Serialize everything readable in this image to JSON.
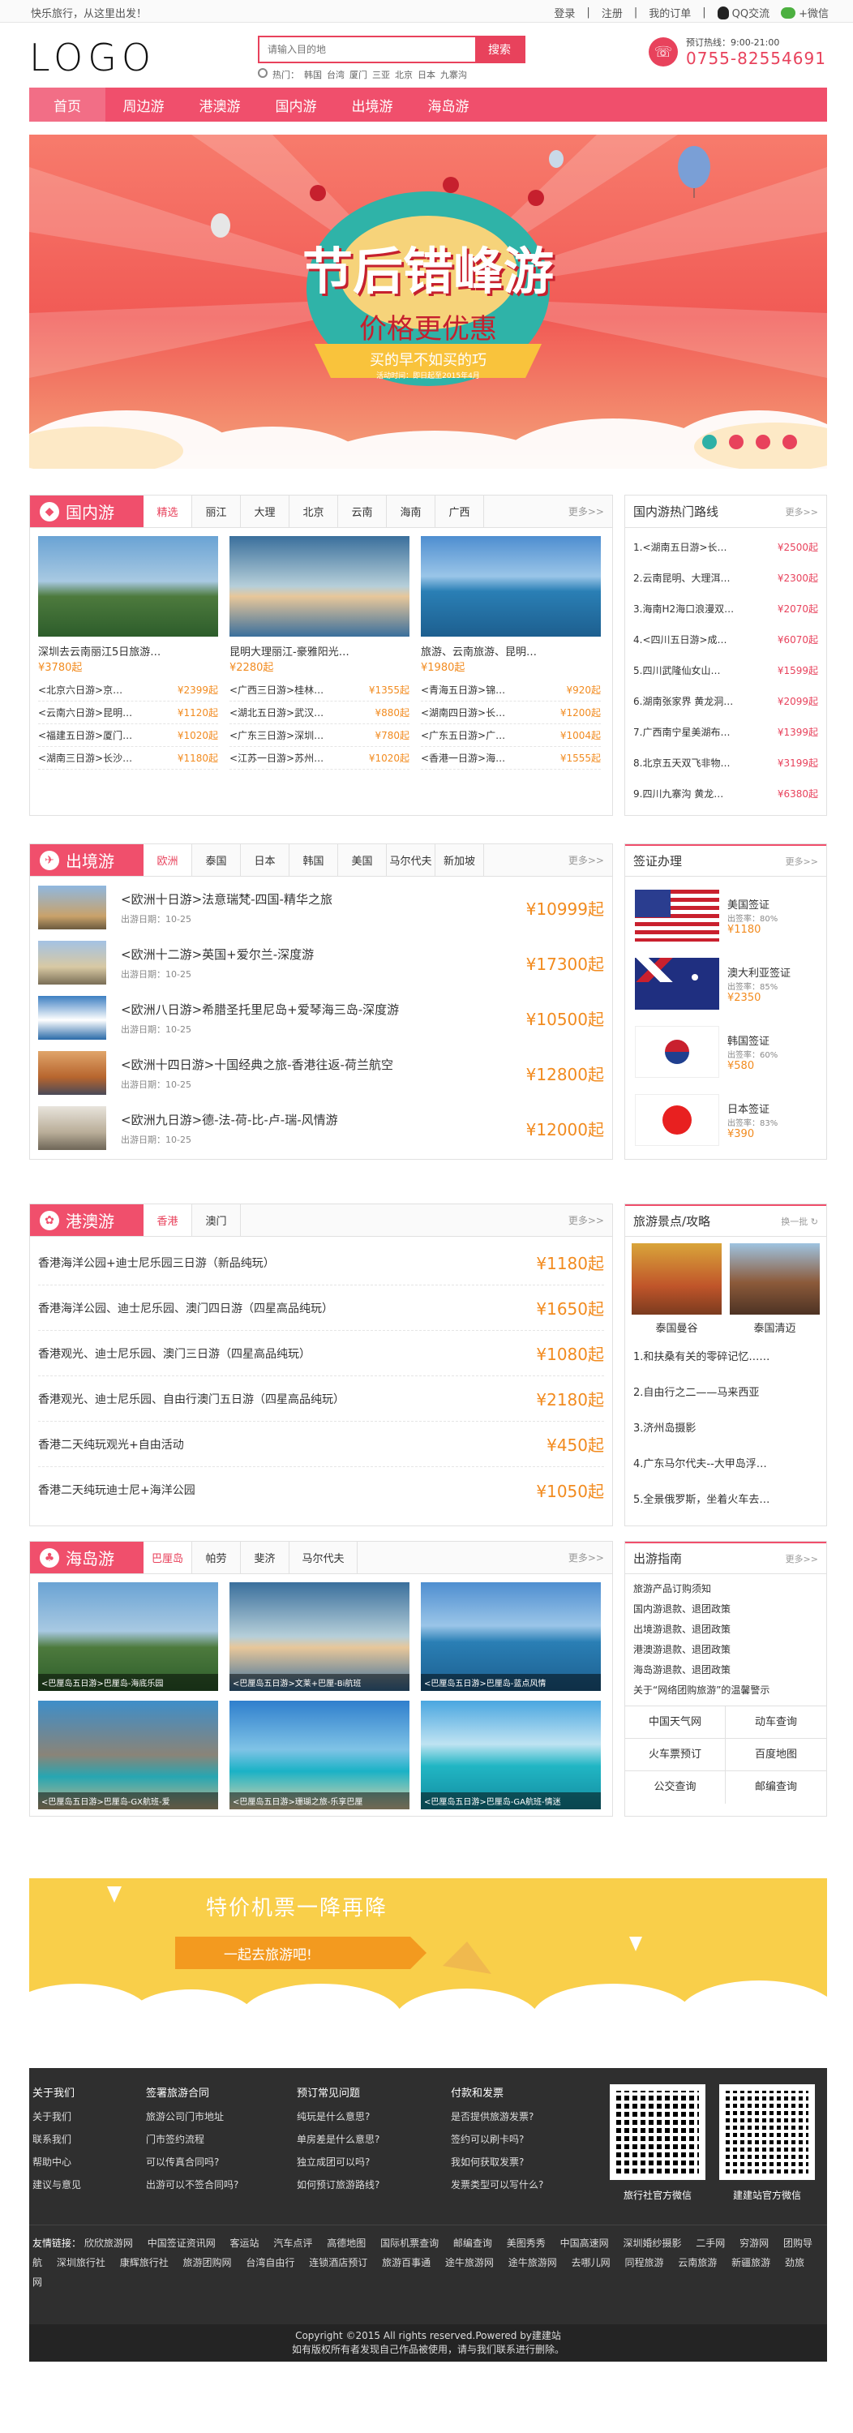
{
  "topbar": {
    "welcome": "快乐旅行，从这里出发！",
    "login": "登录",
    "register": "注册",
    "orders": "我的订单",
    "qq": "QQ交流",
    "weixin": "+微信"
  },
  "logo": "LOGO",
  "search": {
    "placeholder": "请输入目的地",
    "button": "搜索",
    "hot_label": "热门：",
    "hot": [
      "韩国",
      "台湾",
      "厦门",
      "三亚",
      "北京",
      "日本",
      "九寨沟"
    ]
  },
  "hotline": {
    "label": "预订热线：9:00-21:00",
    "number": "0755-82554691"
  },
  "nav": [
    "首页",
    "周边游",
    "港澳游",
    "国内游",
    "出境游",
    "海岛游"
  ],
  "banner": {
    "title": "节后错峰游",
    "subtitle": "价格更优惠",
    "ribbon": "买的早不如买的巧",
    "note": "活动时间：即日起至2015年4月"
  },
  "domestic": {
    "title": "国内游",
    "tabs": [
      "精选",
      "丽江",
      "大理",
      "北京",
      "云南",
      "海南",
      "广西"
    ],
    "more": "更多>>",
    "cards": [
      {
        "name": "深圳去云南丽江5日旅游…",
        "price": "¥3780起"
      },
      {
        "name": "昆明大理丽江-豪雅阳光…",
        "price": "¥2280起"
      },
      {
        "name": "旅游、云南旅游、昆明…",
        "price": "¥1980起"
      }
    ],
    "rows": [
      [
        {
          "name": "<北京六日游>京…",
          "price": "¥2399起"
        },
        {
          "name": "<广西三日游>桂林…",
          "price": "¥1355起"
        },
        {
          "name": "<青海五日游>锦…",
          "price": "¥920起"
        }
      ],
      [
        {
          "name": "<云南六日游>昆明…",
          "price": "¥1120起"
        },
        {
          "name": "<湖北五日游>武汉…",
          "price": "¥880起"
        },
        {
          "name": "<湖南四日游>长…",
          "price": "¥1200起"
        }
      ],
      [
        {
          "name": "<福建五日游>厦门…",
          "price": "¥1020起"
        },
        {
          "name": "<广东三日游>深圳…",
          "price": "¥780起"
        },
        {
          "name": "<广东五日游>广…",
          "price": "¥1004起"
        }
      ],
      [
        {
          "name": "<湖南三日游>长沙…",
          "price": "¥1180起"
        },
        {
          "name": "<江苏一日游>苏州…",
          "price": "¥1020起"
        },
        {
          "name": "<香港一日游>海…",
          "price": "¥1555起"
        }
      ]
    ]
  },
  "domestic_hot": {
    "title": "国内游热门路线",
    "more": "更多>>",
    "items": [
      {
        "name": "1.<湖南五日游>长…",
        "price": "¥2500起"
      },
      {
        "name": "2.云南昆明、大理洱…",
        "price": "¥2300起"
      },
      {
        "name": "3.海南H2海口浪漫双…",
        "price": "¥2070起"
      },
      {
        "name": "4.<四川五日游>成…",
        "price": "¥6070起"
      },
      {
        "name": "5.四川武隆仙女山…",
        "price": "¥1599起"
      },
      {
        "name": "6.湖南张家界 黄龙洞…",
        "price": "¥2099起"
      },
      {
        "name": "7.广西南宁星美湖布…",
        "price": "¥1399起"
      },
      {
        "name": "8.北京五天双飞非物…",
        "price": "¥3199起"
      },
      {
        "name": "9.四川九寨沟 黄龙…",
        "price": "¥6380起"
      }
    ]
  },
  "outbound": {
    "title": "出境游",
    "tabs": [
      "欧洲",
      "泰国",
      "日本",
      "韩国",
      "美国",
      "马尔代夫",
      "新加坡"
    ],
    "more": "更多>>",
    "date_label": "出游日期：",
    "items": [
      {
        "name": "<欧洲十日游>法意瑞梵-四国-精华之旅",
        "date": "10-25",
        "price": "¥10999起"
      },
      {
        "name": "<欧洲十二游>英国+爱尔兰-深度游",
        "date": "10-25",
        "price": "¥17300起"
      },
      {
        "name": "<欧洲八日游>希腊圣托里尼岛+爱琴海三岛-深度游",
        "date": "10-25",
        "price": "¥10500起"
      },
      {
        "name": "<欧洲十四日游>十国经典之旅-香港往返-荷兰航空",
        "date": "10-25",
        "price": "¥12800起"
      },
      {
        "name": "<欧洲九日游>德-法-荷-比-卢-瑞-风情游",
        "date": "10-25",
        "price": "¥12000起"
      }
    ]
  },
  "visa": {
    "title": "签证办理",
    "more": "更多>>",
    "rate_label": "出签率：",
    "items": [
      {
        "name": "美国签证",
        "rate": "80%",
        "price": "¥1180"
      },
      {
        "name": "澳大利亚签证",
        "rate": "85%",
        "price": "¥2350"
      },
      {
        "name": "韩国签证",
        "rate": "60%",
        "price": "¥580"
      },
      {
        "name": "日本签证",
        "rate": "83%",
        "price": "¥390"
      }
    ]
  },
  "hkmacau": {
    "title": "港澳游",
    "tabs": [
      "香港",
      "澳门"
    ],
    "more": "更多>>",
    "items": [
      {
        "name": "香港海洋公园+迪士尼乐园三日游（新品纯玩）",
        "price": "¥1180起"
      },
      {
        "name": "香港海洋公园、迪士尼乐园、澳门四日游（四星高品纯玩）",
        "price": "¥1650起"
      },
      {
        "name": "香港观光、迪士尼乐园、澳门三日游（四星高品纯玩）",
        "price": "¥1080起"
      },
      {
        "name": "香港观光、迪士尼乐园、自由行澳门五日游（四星高品纯玩）",
        "price": "¥2180起"
      },
      {
        "name": "香港二天纯玩观光+自由活动",
        "price": "¥450起"
      },
      {
        "name": "香港二天纯玩迪士尼+海洋公园",
        "price": "¥1050起"
      }
    ]
  },
  "guide": {
    "title": "旅游景点/攻略",
    "refresh": "换一批",
    "pics": [
      "泰国曼谷",
      "泰国清迈"
    ],
    "items": [
      "1.和扶桑有关的零碎记忆……",
      "2.自由行之二——马来西亚",
      "3.济州岛摄影",
      "4.广东马尔代夫--大甲岛浮…",
      "5.全景俄罗斯，坐着火车去…"
    ]
  },
  "island": {
    "title": "海岛游",
    "tabs": [
      "巴厘岛",
      "帕劳",
      "斐济",
      "马尔代夫"
    ],
    "more": "更多>>",
    "cards": [
      "<巴厘岛五日游>巴厘岛-海底乐园",
      "<巴厘岛五日游>文莱+巴厘-Bi航班",
      "<巴厘岛五日游>巴厘岛-蓝点风情",
      "<巴厘岛五日游>巴厘岛-GX航班-爱",
      "<巴厘岛五日游>珊瑚之旅-乐享巴厘",
      "<巴厘岛五日游>巴厘岛-GA航班-情迷"
    ]
  },
  "travel_guide": {
    "title": "出游指南",
    "more": "更多>>",
    "items": [
      "旅游产品订购须知",
      "国内游退款、退团政策",
      "出境游退款、退团政策",
      "港澳游退款、退团政策",
      "海岛游退款、退团政策",
      "关于“网络团购旅游”的温馨警示"
    ],
    "links": [
      "中国天气网",
      "动车查询",
      "火车票预订",
      "百度地图",
      "公交查询",
      "邮编查询"
    ]
  },
  "promo": {
    "title": "特价机票一降再降",
    "subtitle": "一起去旅游吧!"
  },
  "footer": {
    "cols": [
      {
        "head": "关于我们",
        "items": [
          "关于我们",
          "联系我们",
          "帮助中心",
          "建议与意见"
        ]
      },
      {
        "head": "签署旅游合同",
        "items": [
          "旅游公司门市地址",
          "门市签约流程",
          "可以传真合同吗?",
          "出游可以不签合同吗?"
        ]
      },
      {
        "head": "预订常见问题",
        "items": [
          "纯玩是什么意思?",
          "单房差是什么意思?",
          "独立成团可以吗?",
          "如何预订旅游路线?"
        ]
      },
      {
        "head": "付款和发票",
        "items": [
          "是否提供旅游发票?",
          "签约可以刷卡吗?",
          "我如何获取发票?",
          "发票类型可以写什么?"
        ]
      }
    ],
    "qr1": "旅行社官方微信",
    "qr2": "建建站官方微信",
    "links_label": "友情链接：",
    "links": [
      "欣欣旅游网",
      "中国签证资讯网",
      "客运站",
      "汽车点评",
      "高德地图",
      "国际机票查询",
      "邮编查询",
      "美图秀秀",
      "中国高速网",
      "深圳婚纱摄影",
      "二手网",
      "穷游网",
      "团购导航",
      "深圳旅行社",
      "康辉旅行社",
      "旅游团购网",
      "台湾自由行",
      "连锁酒店预订",
      "旅游百事通",
      "途牛旅游网",
      "途牛旅游网",
      "去哪儿网",
      "同程旅游",
      "云南旅游",
      "新疆旅游",
      "劲旅网"
    ],
    "copyright": "Copyright ©2015  All rights reserved.Powered by建建站",
    "notice": "如有版权所有者发现自己作品被使用，请与我们联系进行删除。"
  }
}
